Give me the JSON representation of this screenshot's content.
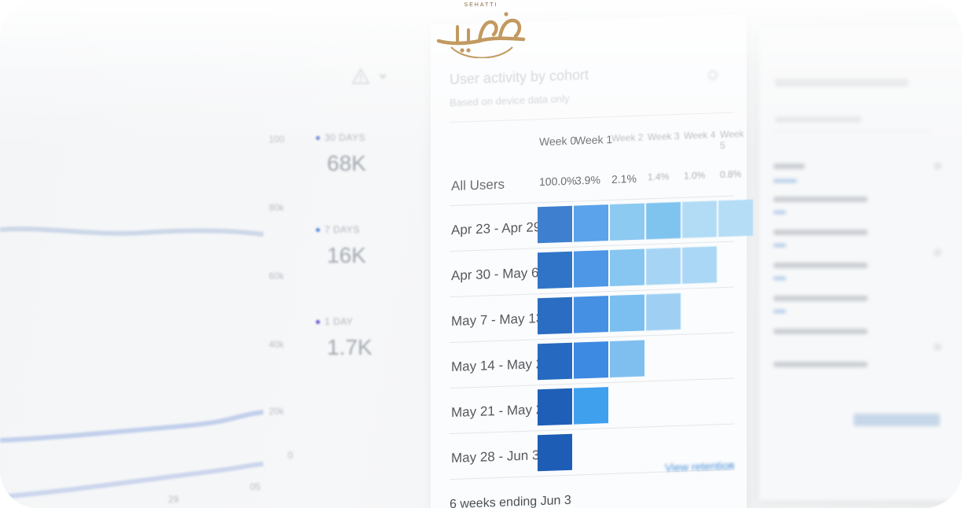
{
  "brand": {
    "name": "SEHATTI",
    "script_text": "صحتي",
    "color": "#c29a60"
  },
  "metrics": {
    "y_ticks": [
      "100",
      "80k",
      "60k",
      "40k",
      "20k",
      "0"
    ],
    "x_ticks": [
      "29",
      "05"
    ],
    "items": [
      {
        "label": "30 DAYS",
        "value": "68K",
        "dot_color": "#5b7fd6"
      },
      {
        "label": "7 DAYS",
        "value": "16K",
        "dot_color": "#4a86e0"
      },
      {
        "label": "1 DAY",
        "value": "1.7K",
        "dot_color": "#5a4fc8"
      }
    ]
  },
  "cohort": {
    "title": "User activity by cohort",
    "subtitle": "Based on device data only",
    "week_headers": [
      "Week 0",
      "Week 1",
      "Week 2",
      "Week 3",
      "Week 4",
      "Week 5"
    ],
    "all_users_label": "All Users",
    "all_users_values": [
      "100.0%",
      "3.9%",
      "2.1%",
      "1.4%",
      "1.0%",
      "0.8%"
    ],
    "rows": [
      {
        "label": "Apr 23 - Apr 29",
        "cells": [
          "#3e7fd0",
          "#5ba3ea",
          "#8ccaf2",
          "#7fc3ef",
          "#b2dcf6",
          "#b5ddf6"
        ]
      },
      {
        "label": "Apr 30 - May 6",
        "cells": [
          "#2f74c7",
          "#4d97e6",
          "#86c6f1",
          "#a6d4f4",
          "#a9d7f5"
        ]
      },
      {
        "label": "May 7 - May 13",
        "cells": [
          "#2a6dc3",
          "#4590e3",
          "#7bbff0",
          "#9fd0f3"
        ]
      },
      {
        "label": "May 14 - May 20",
        "cells": [
          "#2669c0",
          "#3d8ae2",
          "#7fbfef"
        ]
      },
      {
        "label": "May 21 - May 27",
        "cells": [
          "#1f5fb8",
          "#3fa0ee"
        ]
      },
      {
        "label": "May 28 - Jun 3",
        "cells": [
          "#1d5db5"
        ]
      }
    ],
    "view_link": "View retention",
    "footer": "6 weeks ending Jun 3"
  }
}
